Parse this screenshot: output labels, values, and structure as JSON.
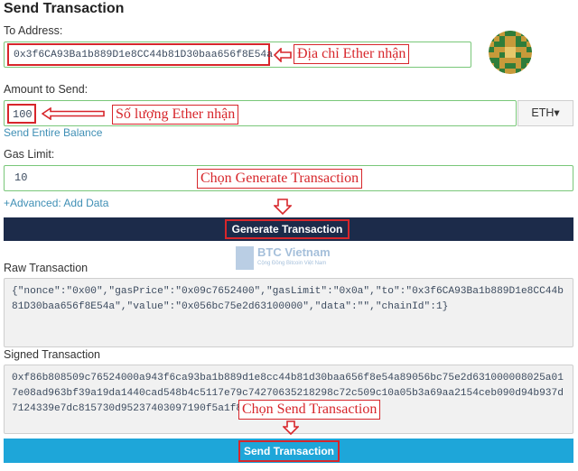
{
  "header": {
    "title": "Send Transaction"
  },
  "to_address": {
    "label": "To Address:",
    "value": "0x3f6CA93Ba1b889D1e8CC44b81D30baa656f8E54a",
    "annotation": "Địa chỉ Ether nhận"
  },
  "amount": {
    "label": "Amount to Send:",
    "value": "100",
    "annotation": "Số lượng Ether nhận",
    "send_entire_balance": "Send Entire Balance",
    "unit": "ETH▾"
  },
  "gas_limit": {
    "label": "Gas Limit:",
    "value": "10",
    "annotation": "Chọn Generate Transaction"
  },
  "advanced_link": "+Advanced: Add Data",
  "generate_button": {
    "label": "Generate Transaction"
  },
  "watermark": {
    "brand": "BTC Vietnam",
    "tagline": "Cộng Đồng Bitcoin Việt Nam"
  },
  "raw_transaction": {
    "label": "Raw Transaction",
    "value": "{\"nonce\":\"0x00\",\"gasPrice\":\"0x09c7652400\",\"gasLimit\":\"0x0a\",\"to\":\"0x3f6CA93Ba1b889D1e8CC44b81D30baa656f8E54a\",\"value\":\"0x056bc75e2d63100000\",\"data\":\"\",\"chainId\":1}"
  },
  "signed_transaction": {
    "label": "Signed Transaction",
    "value": "0xf86b808509c76524000a943f6ca93ba1b889d1e8cc44b81d30baa656f8e54a89056bc75e2d631000008025a017e08ad963bf39a19da1440cad548b4c5117e79c74270635218298c72c509c10a05b3a69aa2154ceb090d94b937d7124339e7dc815730d95237403097190f5a1f8",
    "annotation": "Chọn Send Transaction"
  },
  "send_button": {
    "label": "Send Transaction"
  },
  "colors": {
    "annotation_red": "#d7262b",
    "valid_border": "#79c779",
    "generate_button": "#1c2b4a",
    "send_button": "#1ea6d9",
    "link": "#3f8fb5"
  },
  "icons": {
    "arrow": "red-arrow-icon",
    "identicon": "address-identicon"
  }
}
